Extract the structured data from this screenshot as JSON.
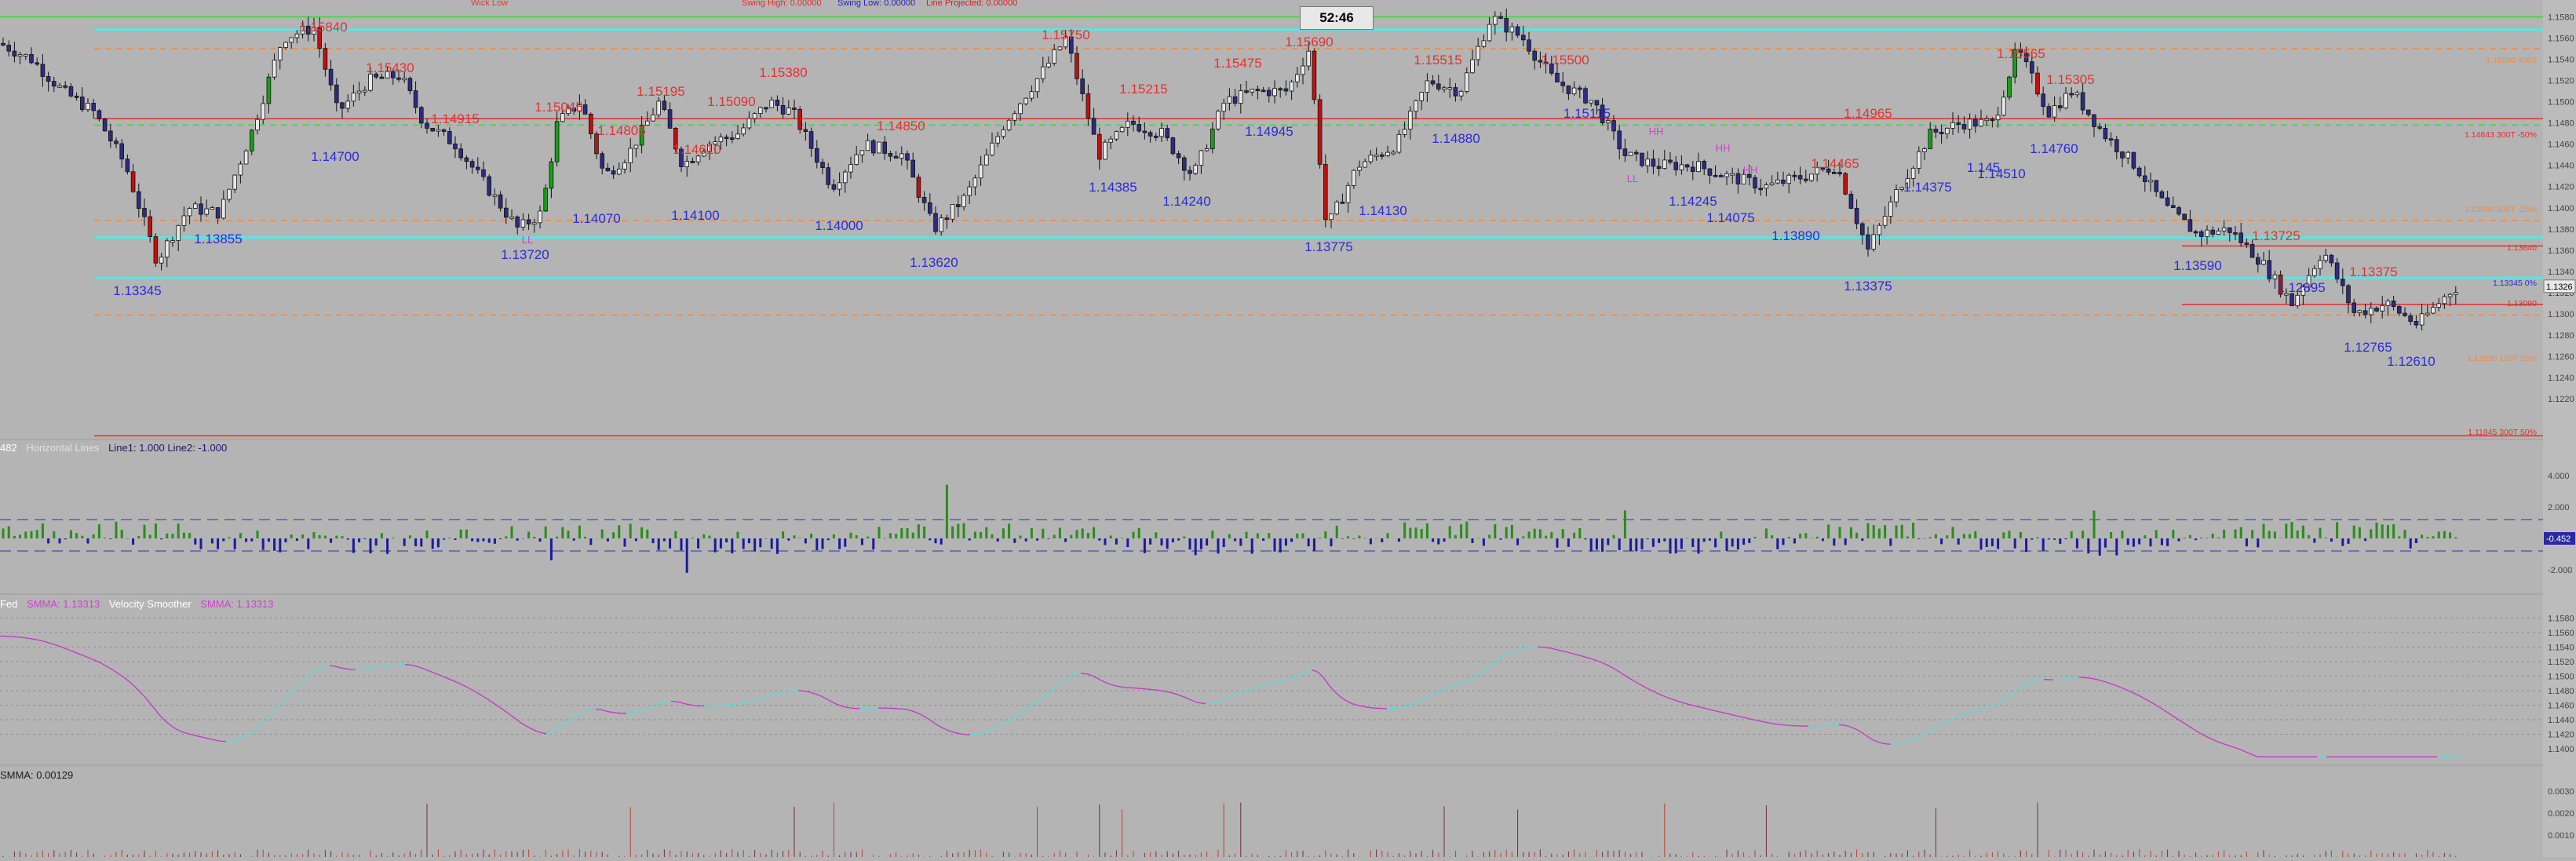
{
  "timer": "52:46",
  "header_labels": [
    {
      "text": "Wick Low",
      "color": "#d64040",
      "x": 600
    },
    {
      "text": "Swing High: 0.00000",
      "color": "#e33030",
      "x": 945
    },
    {
      "text": "Swing Low: 0.00000",
      "color": "#2020c0",
      "x": 1067
    },
    {
      "text": "Line Projected: 0.00000",
      "color": "#d42020",
      "x": 1180
    }
  ],
  "colors": {
    "bg": "#b4b4b4",
    "bull": "#18a018",
    "bear": "#c01010",
    "neutral": "#3a3aa0",
    "high_label": "#e23232",
    "low_label": "#2a2ad8",
    "teal": "#58e6e6",
    "red": "#e03030",
    "orange": "#f08a40",
    "green": "#30e030",
    "magenta": "#d040d0",
    "cyan": "#60e0e0"
  },
  "price_labels": [
    {
      "t": "1.15840",
      "x": 412,
      "y": 40,
      "type": "high"
    },
    {
      "t": "1.15430",
      "x": 497,
      "y": 92,
      "type": "high"
    },
    {
      "t": "1.14915",
      "x": 580,
      "y": 157,
      "type": "high"
    },
    {
      "t": "1.15045",
      "x": 712,
      "y": 142,
      "type": "high"
    },
    {
      "t": "1.14805",
      "x": 792,
      "y": 172,
      "type": "high"
    },
    {
      "t": "1.15195",
      "x": 842,
      "y": 122,
      "type": "high"
    },
    {
      "t": "1.14610",
      "x": 888,
      "y": 196,
      "type": "high"
    },
    {
      "t": "1.15090",
      "x": 932,
      "y": 135,
      "type": "high"
    },
    {
      "t": "1.15380",
      "x": 998,
      "y": 98,
      "type": "high"
    },
    {
      "t": "1.14850",
      "x": 1148,
      "y": 166,
      "type": "high"
    },
    {
      "t": "1.15750",
      "x": 1358,
      "y": 50,
      "type": "high"
    },
    {
      "t": "1.15215",
      "x": 1457,
      "y": 119,
      "type": "high"
    },
    {
      "t": "1.15475",
      "x": 1577,
      "y": 86,
      "type": "high"
    },
    {
      "t": "1.15690",
      "x": 1668,
      "y": 59,
      "type": "high"
    },
    {
      "t": "1.15515",
      "x": 1832,
      "y": 82,
      "type": "high"
    },
    {
      "t": "1.15500",
      "x": 1994,
      "y": 82,
      "type": "high"
    },
    {
      "t": "1.14965",
      "x": 2380,
      "y": 150,
      "type": "high"
    },
    {
      "t": "1.15565",
      "x": 2575,
      "y": 74,
      "type": "high"
    },
    {
      "t": "1.15305",
      "x": 2638,
      "y": 107,
      "type": "high"
    },
    {
      "t": "1.14465",
      "x": 2338,
      "y": 214,
      "type": "high"
    },
    {
      "t": "1.13725",
      "x": 2900,
      "y": 306,
      "type": "high"
    },
    {
      "t": "1.13375",
      "x": 3024,
      "y": 352,
      "type": "high"
    },
    {
      "t": "1.14700",
      "x": 427,
      "y": 205,
      "type": "low"
    },
    {
      "t": "1.13855",
      "x": 278,
      "y": 310,
      "type": "low"
    },
    {
      "t": "1.13345",
      "x": 175,
      "y": 376,
      "type": "low"
    },
    {
      "t": "1.13720",
      "x": 669,
      "y": 330,
      "type": "low"
    },
    {
      "t": "1.14070",
      "x": 760,
      "y": 284,
      "type": "low"
    },
    {
      "t": "1.14100",
      "x": 886,
      "y": 280,
      "type": "low"
    },
    {
      "t": "1.14000",
      "x": 1069,
      "y": 293,
      "type": "low"
    },
    {
      "t": "1.13620",
      "x": 1190,
      "y": 340,
      "type": "low"
    },
    {
      "t": "1.14385",
      "x": 1418,
      "y": 244,
      "type": "low"
    },
    {
      "t": "1.14240",
      "x": 1512,
      "y": 262,
      "type": "low"
    },
    {
      "t": "1.14945",
      "x": 1617,
      "y": 173,
      "type": "low"
    },
    {
      "t": "1.13775",
      "x": 1693,
      "y": 320,
      "type": "low"
    },
    {
      "t": "1.14130",
      "x": 1762,
      "y": 274,
      "type": "low"
    },
    {
      "t": "1.14880",
      "x": 1855,
      "y": 182,
      "type": "low"
    },
    {
      "t": "1.15115",
      "x": 2022,
      "y": 150,
      "type": "low"
    },
    {
      "t": "1.14245",
      "x": 2157,
      "y": 262,
      "type": "low"
    },
    {
      "t": "1.14075",
      "x": 2205,
      "y": 283,
      "type": "low"
    },
    {
      "t": "1.13890",
      "x": 2288,
      "y": 306,
      "type": "low"
    },
    {
      "t": "1.13375",
      "x": 2380,
      "y": 370,
      "type": "low"
    },
    {
      "t": "1.14375",
      "x": 2456,
      "y": 244,
      "type": "low"
    },
    {
      "t": "1.145",
      "x": 2527,
      "y": 219,
      "type": "low"
    },
    {
      "t": "1.14510",
      "x": 2550,
      "y": 227,
      "type": "low"
    },
    {
      "t": "1.14760",
      "x": 2617,
      "y": 195,
      "type": "low"
    },
    {
      "t": "1.13590",
      "x": 2800,
      "y": 344,
      "type": "low"
    },
    {
      "t": "1.12895",
      "x": 2932,
      "y": 372,
      "type": "low"
    },
    {
      "t": "1.12765",
      "x": 3017,
      "y": 448,
      "type": "low"
    },
    {
      "t": "1.12610",
      "x": 3072,
      "y": 466,
      "type": "low"
    }
  ],
  "hhll_marks": [
    {
      "t": "HH",
      "x": 2110,
      "y": 172
    },
    {
      "t": "HH",
      "x": 2195,
      "y": 193
    },
    {
      "t": "HH",
      "x": 2230,
      "y": 221
    },
    {
      "t": "LL",
      "x": 672,
      "y": 310
    },
    {
      "t": "LL",
      "x": 2080,
      "y": 232
    }
  ],
  "right_axis_price": [
    "1.1580",
    "1.1560",
    "1.1540",
    "1.1520",
    "1.1500",
    "1.1480",
    "1.1460",
    "1.1440",
    "1.1420",
    "1.1400",
    "1.1380",
    "1.1360",
    "1.1340",
    "1.1320",
    "1.1300",
    "1.1280",
    "1.1260",
    "1.1240",
    "1.1220"
  ],
  "right_price_badge": "1.1326",
  "right_line_labels": [
    {
      "t": "1.15500 400T",
      "y": 80,
      "color": "#f08a40"
    },
    {
      "t": "1.14843 300T -50%",
      "y": 175,
      "color": "#e03030"
    },
    {
      "t": "1.13880 100T -25%",
      "y": 270,
      "color": "#f08a40"
    },
    {
      "t": "1.13640",
      "y": 319,
      "color": "#e03030"
    },
    {
      "t": "1.13345 0%",
      "y": 364,
      "color": "#3030d0"
    },
    {
      "t": "1.13090",
      "y": 390,
      "color": "#e03030"
    },
    {
      "t": "1.12990 100T 25%",
      "y": 460,
      "color": "#f08a40"
    },
    {
      "t": "1.11845 300T 50%",
      "y": 554,
      "color": "#e03030"
    }
  ],
  "osc_axis": [
    "4.000",
    "2.000",
    "0.000",
    "-2.000"
  ],
  "osc_badge": "-0.452",
  "smma_axis": [
    "1.1580",
    "1.1560",
    "1.1540",
    "1.1520",
    "1.1500",
    "1.1480",
    "1.1460",
    "1.1440",
    "1.1420",
    "1.1400"
  ],
  "bottom_axis": [
    "0.0030",
    "0.0020",
    "0.0010"
  ],
  "pane_labels": {
    "osc": [
      {
        "t": "482",
        "c": "#ffffff"
      },
      {
        "t": "Horizontal Lines",
        "c": "#e0e0e0"
      },
      {
        "t": "Line1: 1.000  Line2: -1.000",
        "c": "#1a1a6a"
      }
    ],
    "smma": [
      {
        "t": "Fed",
        "c": "#ffffff"
      },
      {
        "t": "SMMA: 1.13313",
        "c": "#d040d0"
      },
      {
        "t": "Velocity Smoother",
        "c": "#ffffff"
      },
      {
        "t": "SMMA: 1.13313",
        "c": "#d040d0"
      }
    ],
    "bottom": [
      {
        "t": "SMMA: 0.00129",
        "c": "#1a1a1a"
      }
    ]
  },
  "chart_data": {
    "type": "candlestick",
    "instrument_axis": "price",
    "ylim": [
      1.122,
      1.159
    ],
    "close_series_anchors": [
      [
        0,
        1.1555
      ],
      [
        40,
        1.154
      ],
      [
        80,
        1.151
      ],
      [
        120,
        1.149
      ],
      [
        160,
        1.144
      ],
      [
        200,
        1.135
      ],
      [
        240,
        1.14
      ],
      [
        280,
        1.1395
      ],
      [
        320,
        1.147
      ],
      [
        360,
        1.156
      ],
      [
        400,
        1.157
      ],
      [
        430,
        1.149
      ],
      [
        470,
        1.152
      ],
      [
        510,
        1.1525
      ],
      [
        540,
        1.148
      ],
      [
        580,
        1.146
      ],
      [
        620,
        1.142
      ],
      [
        660,
        1.138
      ],
      [
        690,
        1.1395
      ],
      [
        710,
        1.148
      ],
      [
        740,
        1.15
      ],
      [
        770,
        1.143
      ],
      [
        800,
        1.145
      ],
      [
        840,
        1.15
      ],
      [
        870,
        1.144
      ],
      [
        900,
        1.146
      ],
      [
        940,
        1.147
      ],
      [
        980,
        1.15
      ],
      [
        1010,
        1.149
      ],
      [
        1060,
        1.142
      ],
      [
        1100,
        1.146
      ],
      [
        1150,
        1.145
      ],
      [
        1190,
        1.138
      ],
      [
        1230,
        1.141
      ],
      [
        1280,
        1.148
      ],
      [
        1330,
        1.153
      ],
      [
        1358,
        1.156
      ],
      [
        1400,
        1.145
      ],
      [
        1440,
        1.148
      ],
      [
        1480,
        1.147
      ],
      [
        1520,
        1.143
      ],
      [
        1560,
        1.15
      ],
      [
        1600,
        1.151
      ],
      [
        1640,
        1.151
      ],
      [
        1668,
        1.155
      ],
      [
        1690,
        1.138
      ],
      [
        1730,
        1.144
      ],
      [
        1780,
        1.146
      ],
      [
        1820,
        1.152
      ],
      [
        1860,
        1.151
      ],
      [
        1900,
        1.158
      ],
      [
        1940,
        1.156
      ],
      [
        1980,
        1.152
      ],
      [
        2030,
        1.15
      ],
      [
        2070,
        1.145
      ],
      [
        2110,
        1.144
      ],
      [
        2160,
        1.144
      ],
      [
        2200,
        1.143
      ],
      [
        2250,
        1.142
      ],
      [
        2300,
        1.143
      ],
      [
        2340,
        1.144
      ],
      [
        2380,
        1.136
      ],
      [
        2420,
        1.142
      ],
      [
        2460,
        1.147
      ],
      [
        2500,
        1.148
      ],
      [
        2540,
        1.148
      ],
      [
        2570,
        1.155
      ],
      [
        2610,
        1.149
      ],
      [
        2640,
        1.151
      ],
      [
        2680,
        1.147
      ],
      [
        2720,
        1.144
      ],
      [
        2760,
        1.14
      ],
      [
        2800,
        1.1375
      ],
      [
        2840,
        1.138
      ],
      [
        2880,
        1.135
      ],
      [
        2920,
        1.131
      ],
      [
        2960,
        1.136
      ],
      [
        3000,
        1.13
      ],
      [
        3040,
        1.131
      ],
      [
        3080,
        1.129
      ],
      [
        3120,
        1.132
      ],
      [
        3135,
        1.1328
      ]
    ],
    "horizontal_lines": [
      {
        "y": 1.158,
        "color": "#30e030"
      },
      {
        "y": 1.1568,
        "color": "#58e6e6"
      },
      {
        "y": 1.155,
        "color": "#f08a40",
        "dash": true
      },
      {
        "y": 1.1484,
        "color": "#e03030"
      },
      {
        "y": 1.1478,
        "color": "#30e030",
        "dash": true
      },
      {
        "y": 1.1388,
        "color": "#f08a40",
        "dash": true
      },
      {
        "y": 1.1372,
        "color": "#58e6e6"
      },
      {
        "y": 1.1364,
        "color": "#e03030"
      },
      {
        "y": 1.1334,
        "color": "#58e6e6"
      },
      {
        "y": 1.1309,
        "color": "#e03030"
      },
      {
        "y": 1.1299,
        "color": "#f08a40",
        "dash": true
      },
      {
        "y": 1.1185,
        "color": "#e03030"
      }
    ]
  }
}
